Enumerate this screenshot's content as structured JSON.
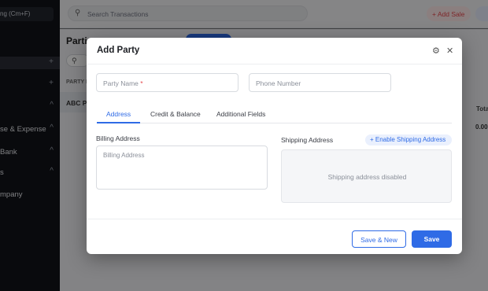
{
  "sidebar": {
    "company": "ng (Cm+F)",
    "items": [
      {
        "label": "",
        "action": "+"
      },
      {
        "label": "",
        "action": "+"
      },
      {
        "label": "",
        "action": "^"
      },
      {
        "label": "se & Expense",
        "action": "^"
      },
      {
        "label": "Bank",
        "action": "^"
      },
      {
        "label": "s",
        "action": "^"
      },
      {
        "label": "mpany",
        "action": ""
      }
    ]
  },
  "topbar": {
    "search_placeholder": "Search Transactions",
    "search_icon": "search-icon",
    "add_sale_label": "+ Add Sale"
  },
  "background": {
    "page_title": "Parti",
    "column_header": "PARTY N",
    "first_row": "ABC P",
    "total_header": "Tota",
    "total_value": "0.00"
  },
  "modal": {
    "title": "Add Party",
    "party_name_placeholder": "Party Name",
    "required_mark": "*",
    "phone_placeholder": "Phone Number",
    "tabs": [
      "Address",
      "Credit & Balance",
      "Additional Fields"
    ],
    "active_tab": "Address",
    "billing_label": "Billing Address",
    "billing_placeholder": "Billing Address",
    "shipping_label": "Shipping Address",
    "enable_shipping_label": "+ Enable Shipping Address",
    "shipping_disabled_text": "Shipping address disabled",
    "save_new_label": "Save & New",
    "save_label": "Save",
    "accent_color": "#2f6be6"
  }
}
